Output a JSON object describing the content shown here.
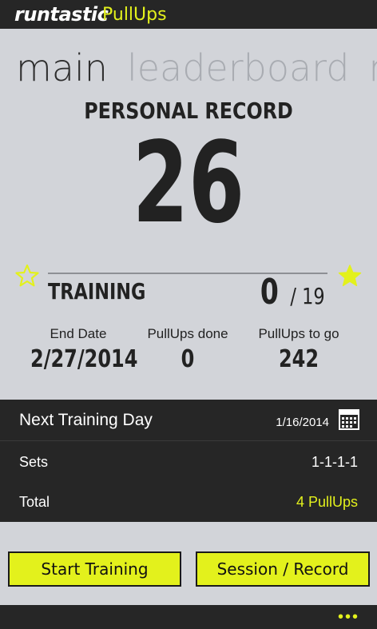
{
  "header": {
    "brand": "runtastic",
    "app_name": "PullUps"
  },
  "pivots": [
    "main",
    "leaderboard",
    "me"
  ],
  "personal_record": {
    "label": "PERSONAL RECORD",
    "value": "26"
  },
  "training": {
    "label": "TRAINING",
    "done": "0",
    "separator_total": "/ 19"
  },
  "stats": [
    {
      "label": "End Date",
      "value": "2/27/2014"
    },
    {
      "label": "PullUps done",
      "value": "0"
    },
    {
      "label": "PullUps to go",
      "value": "242"
    }
  ],
  "details": {
    "next_label": "Next Training Day",
    "next_value": "1/16/2014",
    "sets_label": "Sets",
    "sets_value": "1-1-1-1",
    "total_label": "Total",
    "total_value": "4 PullUps"
  },
  "buttons": {
    "start": "Start Training",
    "session": "Session / Record"
  },
  "appbar": {
    "more": "•••"
  },
  "colors": {
    "accent": "#e3f11c",
    "dark": "#262626",
    "background": "#d2d4d9"
  }
}
